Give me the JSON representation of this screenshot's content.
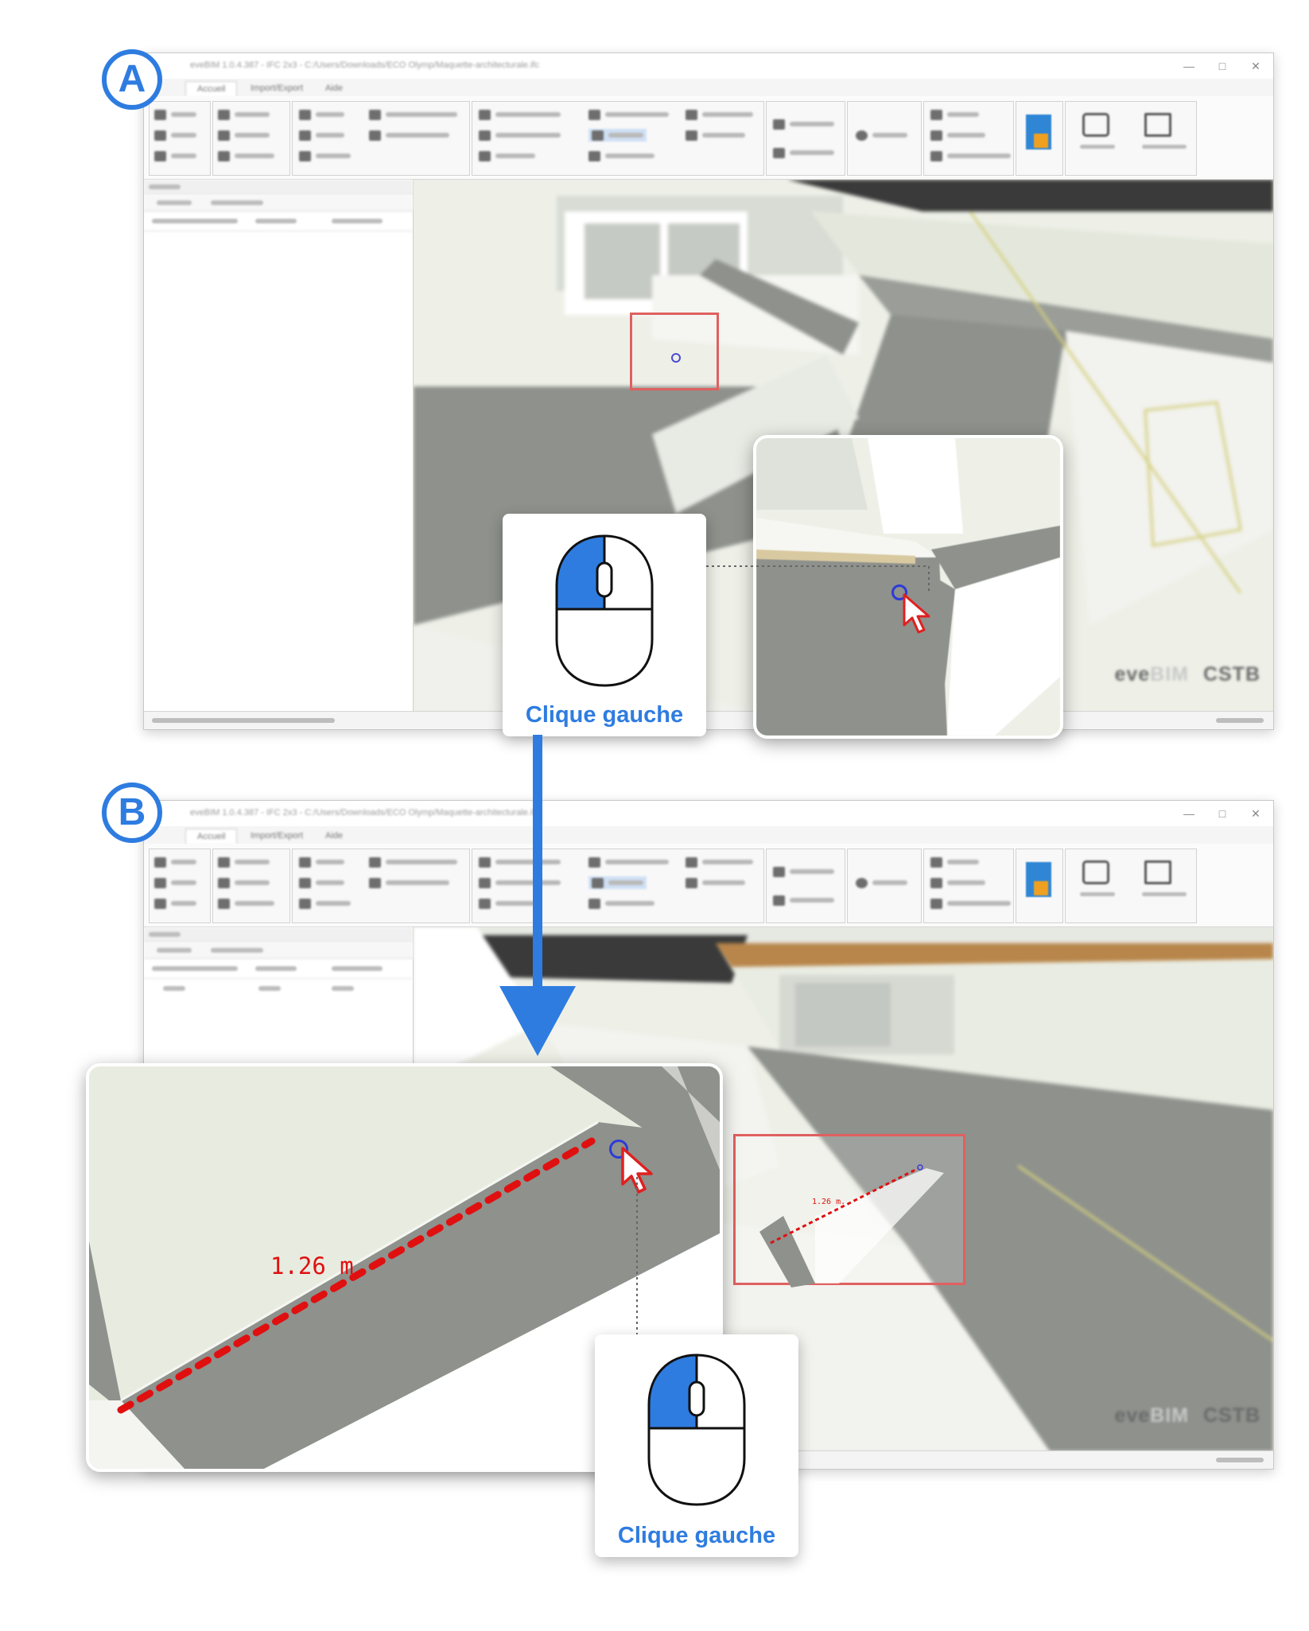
{
  "steps": [
    {
      "label": "A"
    },
    {
      "label": "B"
    }
  ],
  "mouse_cards": [
    {
      "caption": "Clique gauche"
    },
    {
      "caption": "Clique gauche"
    }
  ],
  "watermark": {
    "part1": "eve",
    "part2": "BIM",
    "part3": "CSTB"
  },
  "measure": {
    "label": "1.26 m.",
    "small_label": "1.26 m."
  },
  "colors": {
    "accent_blue": "#2e7ce0",
    "measure_red": "#e01010",
    "highlight_red": "#e06060",
    "floor_gray": "#8e918c",
    "wall_green": "#e8ece0"
  },
  "icons": [
    "mouse-left-click-icon",
    "arrow-cursor-icon",
    "snap-point-icon",
    "down-arrow-icon",
    "minimize-icon",
    "maximize-icon",
    "close-icon"
  ]
}
